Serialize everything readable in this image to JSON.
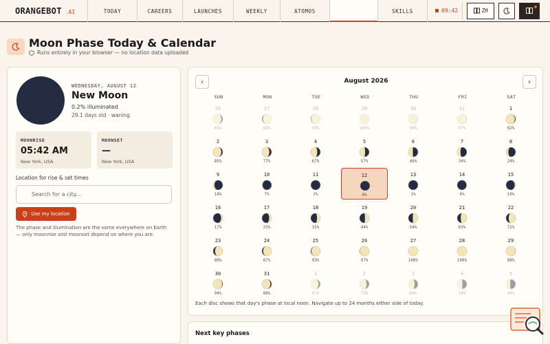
{
  "nav": {
    "brand": "ORANGEBOT",
    "brand_tld": ".AI",
    "links": [
      "TODAY",
      "CAREERS",
      "LAUNCHES",
      "WEEKLY",
      "ATOMOS",
      "",
      "SKILLS"
    ],
    "active_index": 5,
    "timer": "09:42",
    "lang": "ZH",
    "accent": "#c8411b"
  },
  "header": {
    "title": "Moon Phase Today & Calendar",
    "subtitle": "Runs entirely in your browser — no location data uploaded"
  },
  "today": {
    "date_label": "WEDNESDAY, AUGUST 12",
    "phase_name": "New Moon",
    "illumination": "0.2% illuminated",
    "age": "29.1 days old · waning",
    "moonrise": {
      "label": "MOONRISE",
      "value": "05:42 AM",
      "location": "New York, USA"
    },
    "moonset": {
      "label": "MOONSET",
      "value": "—",
      "location": "New York, USA"
    },
    "location_label": "Location for rise & set times",
    "search_placeholder": "Search for a city...",
    "use_location_label": "Use my location",
    "note": "The phase and illumination are the same everywhere on Earth — only moonrise and moonset depend on where you are."
  },
  "calendar": {
    "month_label": "August 2026",
    "weekdays": [
      "SUN",
      "MON",
      "TUE",
      "WED",
      "THU",
      "FRI",
      "SAT"
    ],
    "today_index": 17,
    "days": [
      {
        "d": "26",
        "pct": "85%",
        "illum": 0.85,
        "waxing": false,
        "other": true
      },
      {
        "d": "27",
        "pct": "89%",
        "illum": 0.89,
        "waxing": true,
        "other": true
      },
      {
        "d": "28",
        "pct": "93%",
        "illum": 0.93,
        "waxing": true,
        "other": true
      },
      {
        "d": "29",
        "pct": "100%",
        "illum": 1.0,
        "waxing": true,
        "other": true
      },
      {
        "d": "30",
        "pct": "99%",
        "illum": 0.99,
        "waxing": false,
        "other": true
      },
      {
        "d": "31",
        "pct": "97%",
        "illum": 0.97,
        "waxing": false,
        "other": true
      },
      {
        "d": "1",
        "pct": "92%",
        "illum": 0.92,
        "waxing": false,
        "other": false
      },
      {
        "d": "2",
        "pct": "85%",
        "illum": 0.85,
        "waxing": false,
        "other": false
      },
      {
        "d": "3",
        "pct": "77%",
        "illum": 0.77,
        "waxing": false,
        "other": false
      },
      {
        "d": "4",
        "pct": "67%",
        "illum": 0.67,
        "waxing": false,
        "other": false
      },
      {
        "d": "5",
        "pct": "57%",
        "illum": 0.57,
        "waxing": false,
        "other": false
      },
      {
        "d": "6",
        "pct": "46%",
        "illum": 0.46,
        "waxing": false,
        "other": false
      },
      {
        "d": "7",
        "pct": "34%",
        "illum": 0.34,
        "waxing": false,
        "other": false
      },
      {
        "d": "8",
        "pct": "24%",
        "illum": 0.24,
        "waxing": false,
        "other": false
      },
      {
        "d": "9",
        "pct": "14%",
        "illum": 0.14,
        "waxing": false,
        "other": false
      },
      {
        "d": "10",
        "pct": "7%",
        "illum": 0.07,
        "waxing": false,
        "other": false
      },
      {
        "d": "11",
        "pct": "2%",
        "illum": 0.02,
        "waxing": false,
        "other": false
      },
      {
        "d": "12",
        "pct": "0%",
        "illum": 0.0,
        "waxing": false,
        "other": false
      },
      {
        "d": "13",
        "pct": "1%",
        "illum": 0.01,
        "waxing": true,
        "other": false
      },
      {
        "d": "14",
        "pct": "4%",
        "illum": 0.04,
        "waxing": true,
        "other": false
      },
      {
        "d": "15",
        "pct": "10%",
        "illum": 0.1,
        "waxing": true,
        "other": false
      },
      {
        "d": "16",
        "pct": "17%",
        "illum": 0.17,
        "waxing": true,
        "other": false
      },
      {
        "d": "17",
        "pct": "25%",
        "illum": 0.25,
        "waxing": true,
        "other": false
      },
      {
        "d": "18",
        "pct": "35%",
        "illum": 0.35,
        "waxing": true,
        "other": false
      },
      {
        "d": "19",
        "pct": "44%",
        "illum": 0.44,
        "waxing": true,
        "other": false
      },
      {
        "d": "20",
        "pct": "54%",
        "illum": 0.54,
        "waxing": true,
        "other": false
      },
      {
        "d": "21",
        "pct": "63%",
        "illum": 0.63,
        "waxing": true,
        "other": false
      },
      {
        "d": "22",
        "pct": "72%",
        "illum": 0.72,
        "waxing": true,
        "other": false
      },
      {
        "d": "23",
        "pct": "80%",
        "illum": 0.8,
        "waxing": true,
        "other": false
      },
      {
        "d": "24",
        "pct": "87%",
        "illum": 0.87,
        "waxing": true,
        "other": false
      },
      {
        "d": "25",
        "pct": "93%",
        "illum": 0.93,
        "waxing": true,
        "other": false
      },
      {
        "d": "26",
        "pct": "97%",
        "illum": 0.97,
        "waxing": true,
        "other": false
      },
      {
        "d": "27",
        "pct": "100%",
        "illum": 1.0,
        "waxing": true,
        "other": false
      },
      {
        "d": "28",
        "pct": "100%",
        "illum": 1.0,
        "waxing": false,
        "other": false
      },
      {
        "d": "29",
        "pct": "98%",
        "illum": 0.98,
        "waxing": false,
        "other": false
      },
      {
        "d": "30",
        "pct": "94%",
        "illum": 0.94,
        "waxing": false,
        "other": false
      },
      {
        "d": "31",
        "pct": "88%",
        "illum": 0.88,
        "waxing": false,
        "other": false
      },
      {
        "d": "1",
        "pct": "81%",
        "illum": 0.81,
        "waxing": false,
        "other": true
      },
      {
        "d": "2",
        "pct": "73%",
        "illum": 0.73,
        "waxing": false,
        "other": true
      },
      {
        "d": "3",
        "pct": "64%",
        "illum": 0.64,
        "waxing": false,
        "other": true
      },
      {
        "d": "4",
        "pct": "54%",
        "illum": 0.54,
        "waxing": false,
        "other": true
      },
      {
        "d": "5",
        "pct": "44%",
        "illum": 0.44,
        "waxing": false,
        "other": true
      }
    ],
    "footnote": "Each disc shows that day's phase at local noon. Navigate up to 24 months either side of today.",
    "colors": {
      "dark": "#232c41",
      "light": "#f3e5b8"
    }
  },
  "next_phases": {
    "title": "Next key phases"
  }
}
